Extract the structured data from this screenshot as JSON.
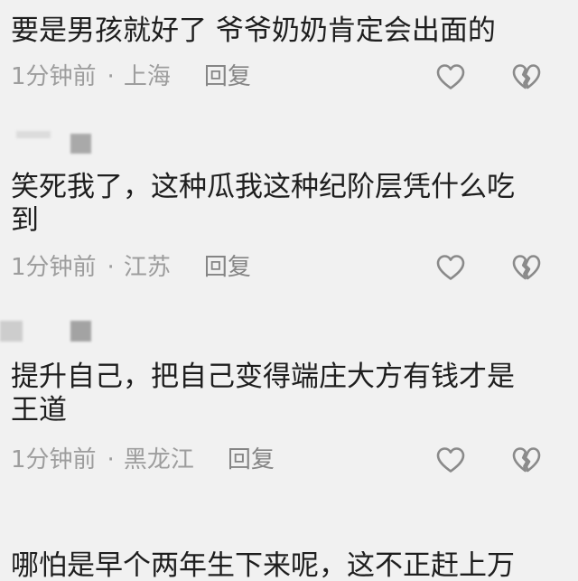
{
  "colors": {
    "background": "#f1f1f1",
    "text": "#1e1e1e",
    "meta": "#9d9d9d",
    "reply": "#858585",
    "icon": "#8a8a8a"
  },
  "comments": [
    {
      "text": "要是男孩就好了 爷爷奶奶肯定会出面的",
      "time": "1分钟前",
      "separator": "·",
      "location": "上海",
      "reply_label": "回复",
      "like_icon": "heart-outline-icon",
      "dislike_icon": "broken-heart-icon"
    },
    {
      "text": "笑死我了，这种瓜我这种纪阶层凭什么吃到",
      "time": "1分钟前",
      "separator": "·",
      "location": "江苏",
      "reply_label": "回复",
      "like_icon": "heart-outline-icon",
      "dislike_icon": "broken-heart-icon"
    },
    {
      "text": "提升自己，把自己变得端庄大方有钱才是王道",
      "time": "1分钟前",
      "separator": "·",
      "location": "黑龙江",
      "reply_label": "回复",
      "like_icon": "heart-outline-icon",
      "dislike_icon": "broken-heart-icon"
    },
    {
      "text": "哪怕是早个两年生下来呢，这不正赶上万"
    }
  ]
}
